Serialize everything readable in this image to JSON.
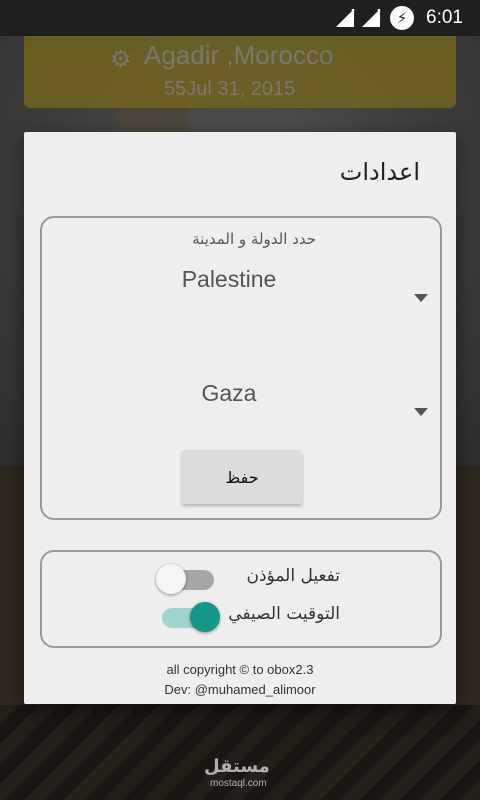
{
  "status_bar": {
    "time": "6:01",
    "signal_icon": "signal-icon",
    "battery_icon": "battery-charging-icon",
    "battery_glyph": "⚡"
  },
  "header": {
    "location": "Agadir ,Morocco",
    "date": "55Jul 31, 2015",
    "gear_icon": "gear-icon"
  },
  "dialog": {
    "title": "اعدادات",
    "location_panel": {
      "label": "حدد الدولة و المدينة",
      "country": "Palestine",
      "city": "Gaza",
      "save_label": "حفظ"
    },
    "options_panel": {
      "adhan_label": "تفعيل المؤذن",
      "adhan_enabled": false,
      "dst_label": "التوقيت الصيفي",
      "dst_enabled": true
    },
    "footer": {
      "copyright": "all copyright © to obox2.3",
      "dev": "Dev: @muhamed_alimoor"
    }
  },
  "watermark": {
    "text": "مستقل",
    "sub": "mostaql.com"
  },
  "colors": {
    "accent": "#159688",
    "header_bg": "#b8a02c"
  }
}
